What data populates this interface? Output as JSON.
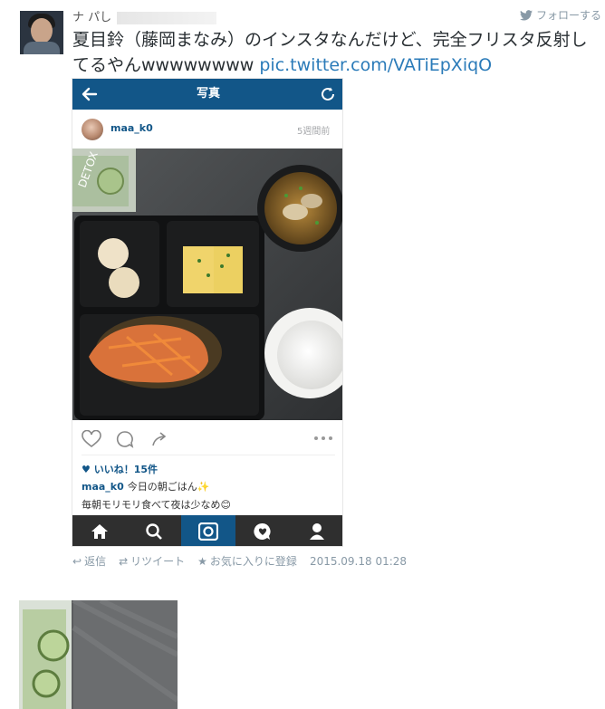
{
  "tweet": {
    "author_fragment": "ナ パし",
    "follow_label": "フォローする",
    "text": "夏目鈴（藤岡まなみ）のインスタなんだけど、完全フリスタ反射してるやんwwwwwwww ",
    "link_text": "pic.twitter.com/VATiEpXiqO",
    "actions": {
      "reply": "返信",
      "retweet": "リツイート",
      "favorite": "お気に入りに登録"
    },
    "timestamp": "2015.09.18 01:28"
  },
  "instagram": {
    "header_title": "写真",
    "username": "maa_k0",
    "time_ago": "5週間前",
    "likes": "いいね！15件",
    "caption_user": "maa_k0",
    "caption_text": "今日の朝ごはん✨",
    "comment_text": "毎朝モリモリ食べて夜は少なめ😊",
    "colors": {
      "brand": "#125688",
      "nav_bg": "#2f2f2f"
    },
    "icons": [
      "back-arrow-icon",
      "refresh-icon",
      "heart-icon",
      "comment-icon",
      "share-icon",
      "more-icon",
      "home-icon",
      "search-icon",
      "camera-icon",
      "activity-icon",
      "profile-icon"
    ]
  },
  "colors": {
    "link": "#2b7bb9",
    "muted": "#8899a6",
    "text": "#292f33"
  }
}
